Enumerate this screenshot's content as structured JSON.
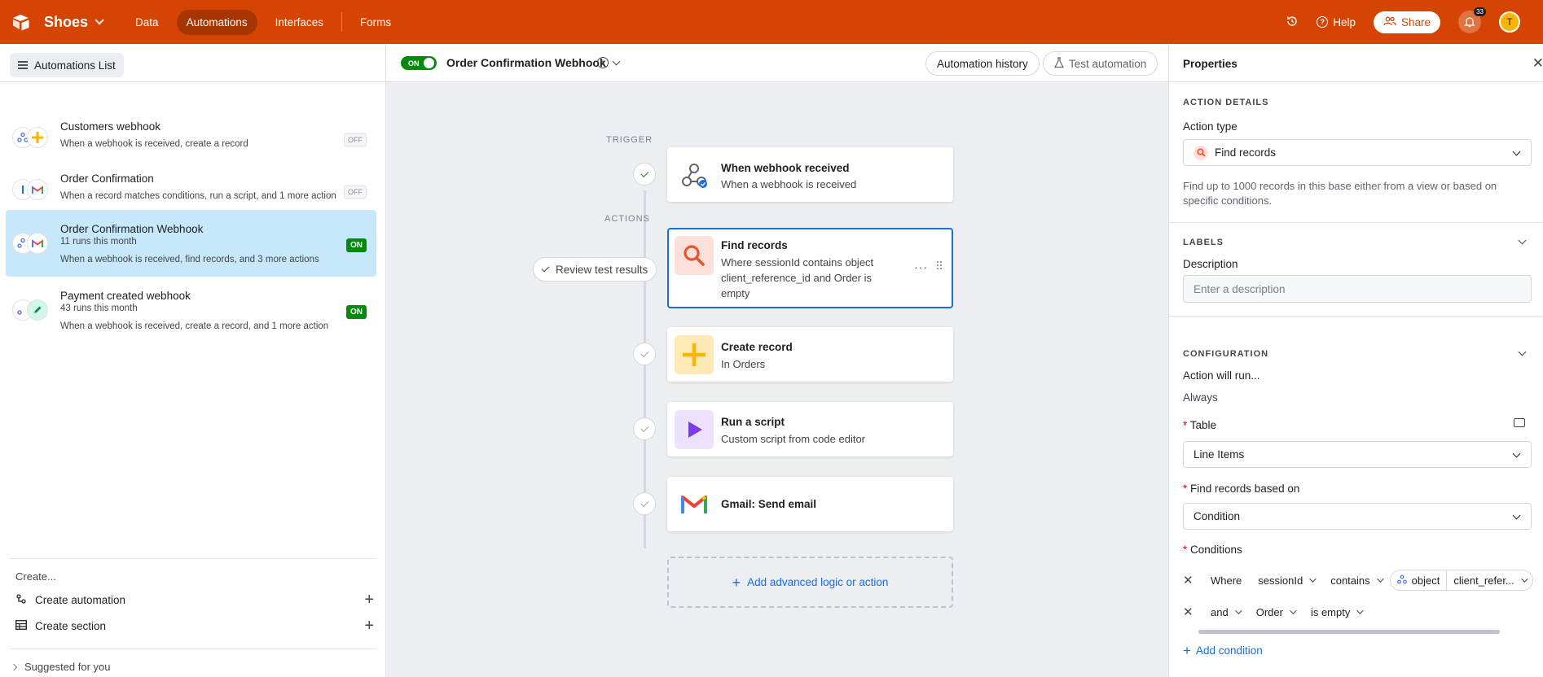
{
  "topbar": {
    "base_name": "Shoes",
    "nav": [
      "Data",
      "Automations",
      "Interfaces",
      "Forms"
    ],
    "active_nav": "Automations",
    "help": "Help",
    "share": "Share",
    "notifications": "33",
    "avatar_initial": "T",
    "colors": {
      "bar": "#d54402"
    }
  },
  "left": {
    "list_button": "Automations List",
    "items": [
      {
        "title": "Customers webhook",
        "runs": "",
        "desc": "When a webhook is received, create a record",
        "state": "OFF",
        "icons": [
          "webhook-icon",
          "plus-icon"
        ]
      },
      {
        "title": "Order Confirmation",
        "runs": "",
        "desc": "When a record matches conditions, run a script, and 1 more action",
        "state": "OFF",
        "icons": [
          "record-icon",
          "gmail-icon"
        ]
      },
      {
        "title": "Order Confirmation Webhook",
        "runs": "11 runs this month",
        "desc": "When a webhook is received, find records, and 3 more actions",
        "state": "ON",
        "icons": [
          "webhook-icon",
          "gmail-icon"
        ]
      },
      {
        "title": "Payment created webhook",
        "runs": "43 runs this month",
        "desc": "When a webhook is received, create a record, and 1 more action",
        "state": "ON",
        "icons": [
          "webhook-icon",
          "pencil-icon"
        ]
      }
    ],
    "create_label": "Create...",
    "create_automation": "Create automation",
    "create_section": "Create section",
    "suggested": "Suggested for you"
  },
  "canvas": {
    "toggle": "ON",
    "automation_name": "Order Confirmation Webhook",
    "history_button": "Automation history",
    "test_button": "Test automation",
    "trigger_label": "TRIGGER",
    "actions_label": "ACTIONS",
    "review": "Review test results",
    "steps": [
      {
        "title": "When webhook received",
        "sub": "When a webhook is received",
        "icon": "webhook-icon"
      },
      {
        "title": "Find records",
        "sub": "Where sessionId contains object client_reference_id and Order is empty",
        "icon": "search-icon"
      },
      {
        "title": "Create record",
        "sub": "In Orders",
        "icon": "plus-icon"
      },
      {
        "title": "Run a script",
        "sub": "Custom script from code editor",
        "icon": "play-icon"
      },
      {
        "title": "Gmail: Send email",
        "sub": "",
        "icon": "gmail-icon"
      }
    ],
    "add_logic": "Add advanced logic or action"
  },
  "properties": {
    "title": "Properties",
    "action_details": "ACTION DETAILS",
    "action_type_label": "Action type",
    "action_type_value": "Find records",
    "help_text": "Find up to 1000 records in this base either from a view or based on specific conditions.",
    "labels_section": "LABELS",
    "description_label": "Description",
    "description_placeholder": "Enter a description",
    "configuration_section": "CONFIGURATION",
    "action_will_run": "Action will run...",
    "always": "Always",
    "table_label": "Table",
    "table_value": "Line Items",
    "find_based_label": "Find records based on",
    "find_based_value": "Condition",
    "conditions_label": "Conditions",
    "cond1": {
      "prefix": "Where",
      "field": "sessionId",
      "op": "contains",
      "obj": "object",
      "val": "client_refer..."
    },
    "cond2": {
      "prefix": "and",
      "field": "Order",
      "op": "is empty"
    },
    "add_condition": "Add condition"
  }
}
